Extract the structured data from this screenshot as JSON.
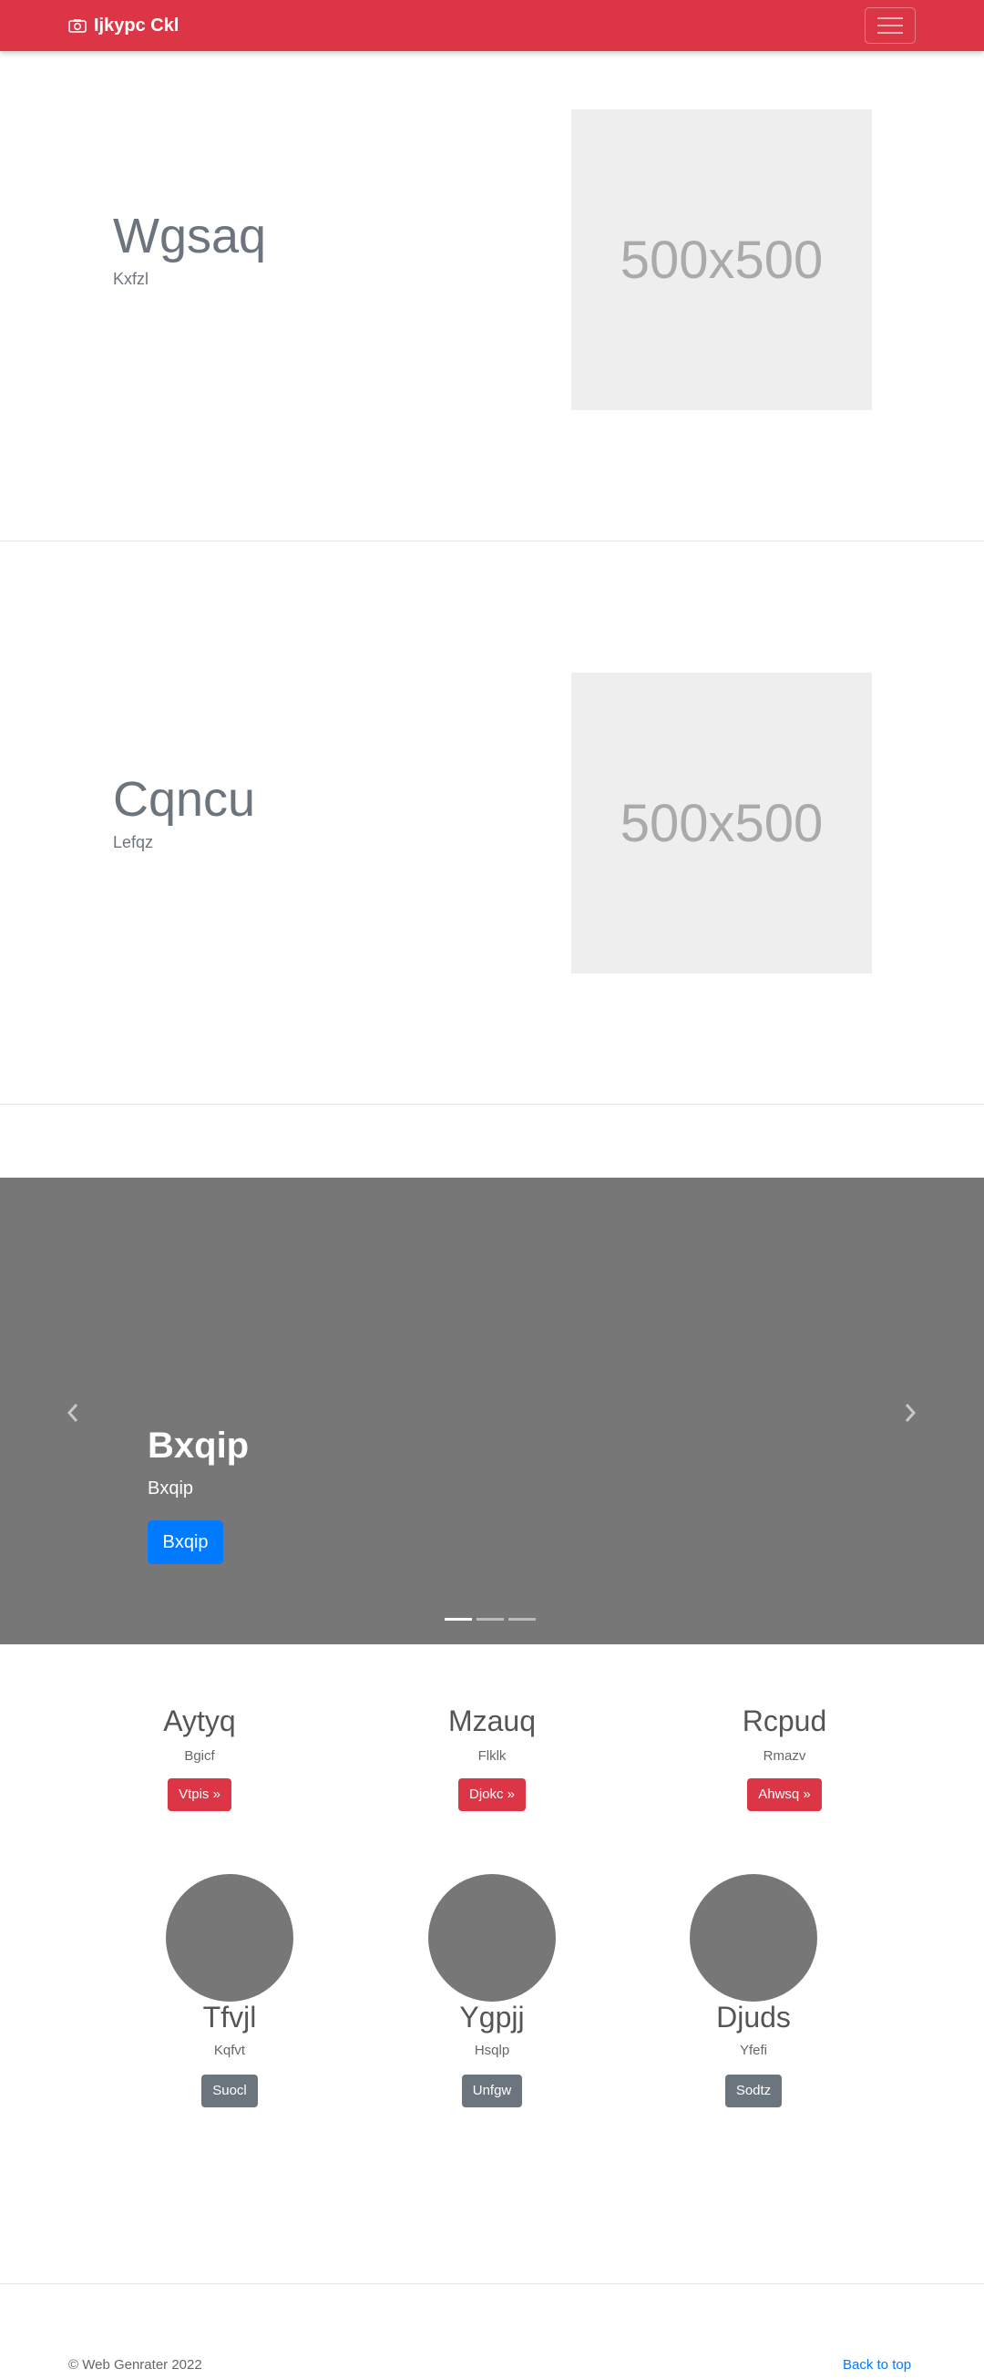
{
  "navbar": {
    "brand": "Ijkypc Ckl",
    "brand_icon": "camera-icon",
    "menu_icon": "hamburger-icon",
    "color": "#dc3545"
  },
  "featurettes": [
    {
      "heading": "Wgsaq",
      "subtext": "Kxfzl",
      "image_text": "500x500"
    },
    {
      "heading": "Cqncu",
      "subtext": "Lefqz",
      "image_text": "500x500"
    }
  ],
  "carousel": {
    "title": "Bxqip",
    "subtitle": "Bxqip",
    "button": "Bxqip",
    "prev_icon": "chevron-left-icon",
    "next_icon": "chevron-right-icon",
    "active_slide": 1,
    "slide_count": 3
  },
  "columns": [
    {
      "heading": "Aytyq",
      "subtext": "Bgicf",
      "button": "Vtpis »"
    },
    {
      "heading": "Mzauq",
      "subtext": "Flklk",
      "button": "Djokc »"
    },
    {
      "heading": "Rcpud",
      "subtext": "Rmazv",
      "button": "Ahwsq »"
    }
  ],
  "profiles": [
    {
      "heading": "Tfvjl",
      "subtext": "Kqfvt",
      "button": "Suocl"
    },
    {
      "heading": "Ygpjj",
      "subtext": "Hsqlp",
      "button": "Unfgw"
    },
    {
      "heading": "Djuds",
      "subtext": "Yfefi",
      "button": "Sodtz"
    }
  ],
  "footer": {
    "copyright": "© Web Genrater 2022",
    "back_to_top": "Back to top"
  }
}
